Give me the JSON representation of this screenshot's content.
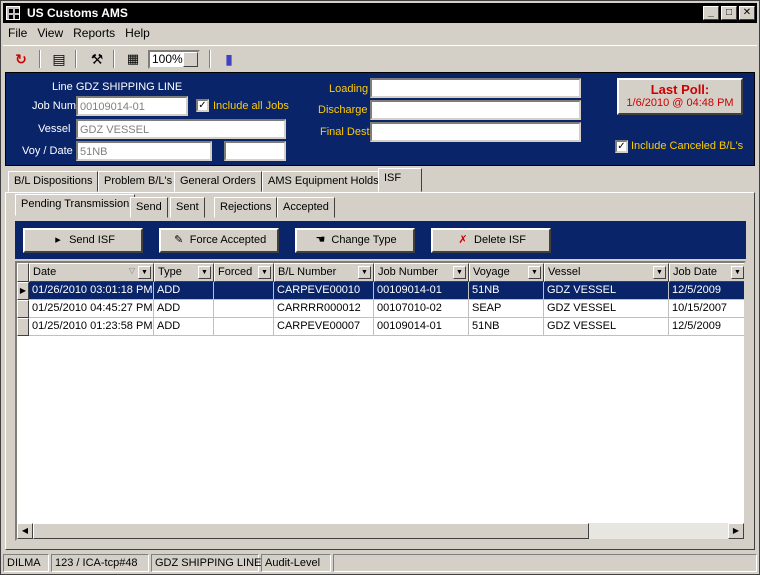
{
  "window": {
    "title": "US Customs AMS",
    "min": "_",
    "max": "□",
    "close": "✕"
  },
  "menu": {
    "file": "File",
    "view": "View",
    "reports": "Reports",
    "help": "Help"
  },
  "toolbar": {
    "zoom": "100%"
  },
  "header": {
    "line_label": "Line GDZ SHIPPING LINE",
    "job_num_label": "Job Num",
    "job_num_value": "00109014-01",
    "include_all_jobs_label": "Include all Jobs",
    "vessel_label": "Vessel",
    "vessel_value": "GDZ VESSEL",
    "voy_label": "Voy / Date",
    "voy_value": "51NB",
    "date_value": "",
    "loading_label": "Loading",
    "loading_value": "",
    "discharge_label": "Discharge",
    "discharge_value": "",
    "final_dest_label": "Final Dest",
    "final_dest_value": "",
    "last_poll_title": "Last Poll:",
    "last_poll_value": "1/6/2010 @ 04:48 PM",
    "include_canceled_label": "Include Canceled B/L's"
  },
  "tabs": [
    "B/L Dispositions",
    "Problem B/L's",
    "General Orders",
    "AMS Equipment Holds",
    "ISF"
  ],
  "subtabs": [
    "Pending Transmission",
    "Send",
    "Sent",
    "Rejections",
    "Accepted"
  ],
  "actions": {
    "send_isf": "Send ISF",
    "force_accepted": "Force Accepted",
    "change_type": "Change Type",
    "delete_isf": "Delete ISF"
  },
  "grid": {
    "columns": [
      "Date",
      "Type",
      "Forced",
      "B/L Number",
      "Job Number",
      "Voyage",
      "Vessel",
      "Job Date"
    ],
    "rows": [
      [
        "01/26/2010 03:01:18 PM",
        "ADD",
        "",
        "CARPEVE00010",
        "00109014-01",
        "51NB",
        "GDZ VESSEL",
        "12/5/2009"
      ],
      [
        "01/25/2010 04:45:27 PM",
        "ADD",
        "",
        "CARRRR000012",
        "00107010-02",
        "SEAP",
        "GDZ VESSEL",
        "10/15/2007"
      ],
      [
        "01/25/2010 01:23:58 PM",
        "ADD",
        "",
        "CARPEVE00007",
        "00109014-01",
        "51NB",
        "GDZ VESSEL",
        "12/5/2009"
      ]
    ]
  },
  "status": [
    "DILMA",
    "123 / ICA-tcp#48",
    "GDZ SHIPPING LINE",
    "Audit-Level"
  ],
  "colors": {
    "panel_blue": "#0a246a",
    "label_yellow": "#ffcc00",
    "poll_red": "#cc0000"
  }
}
